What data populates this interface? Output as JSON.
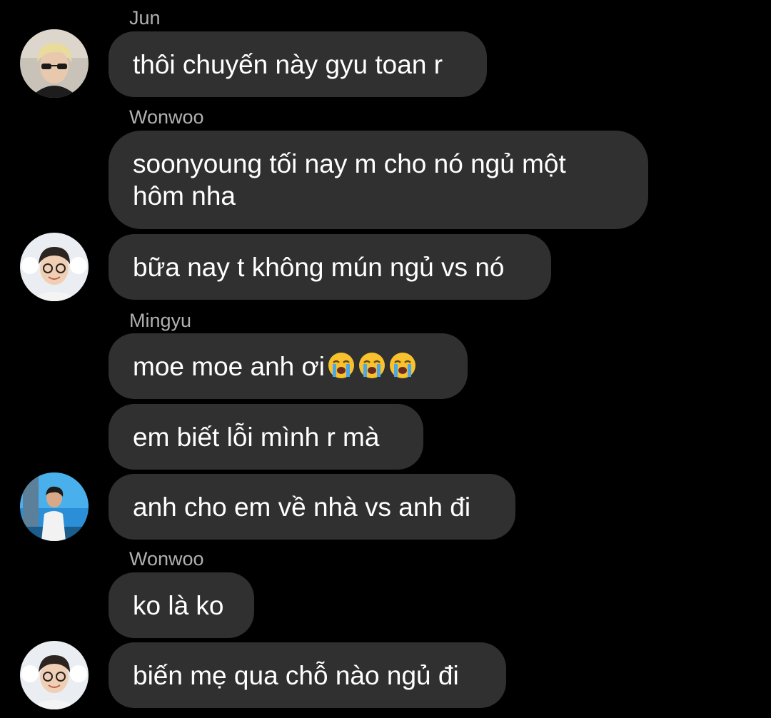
{
  "messages": [
    {
      "sender": "Jun",
      "text": "thôi chuyến này gyu toan r"
    },
    {
      "sender": "Wonwoo",
      "text": "soonyoung tối nay m cho nó ngủ một hôm nha"
    },
    {
      "text": "bữa nay t không mún ngủ vs nó"
    },
    {
      "sender": "Mingyu",
      "text": "moe moe anh ơi",
      "emoji": [
        "loudly-crying-face",
        "loudly-crying-face",
        "loudly-crying-face"
      ]
    },
    {
      "text": "em biết lỗi mình r mà"
    },
    {
      "text": "anh cho em về nhà vs anh đi"
    },
    {
      "sender": "Wonwoo",
      "text": "ko là ko"
    },
    {
      "text": "biến mẹ qua chỗ nào ngủ đi"
    }
  ],
  "avatars": [
    {
      "person": "Jun",
      "icon": "avatar-photo"
    },
    {
      "person": "Wonwoo",
      "icon": "avatar-photo"
    },
    {
      "person": "Mingyu",
      "icon": "avatar-photo"
    },
    {
      "person": "Wonwoo",
      "icon": "avatar-photo"
    }
  ],
  "colors": {
    "background": "#000000",
    "bubble": "#303030",
    "sender_name": "#b0b0b0",
    "message_text": "#ffffff"
  }
}
